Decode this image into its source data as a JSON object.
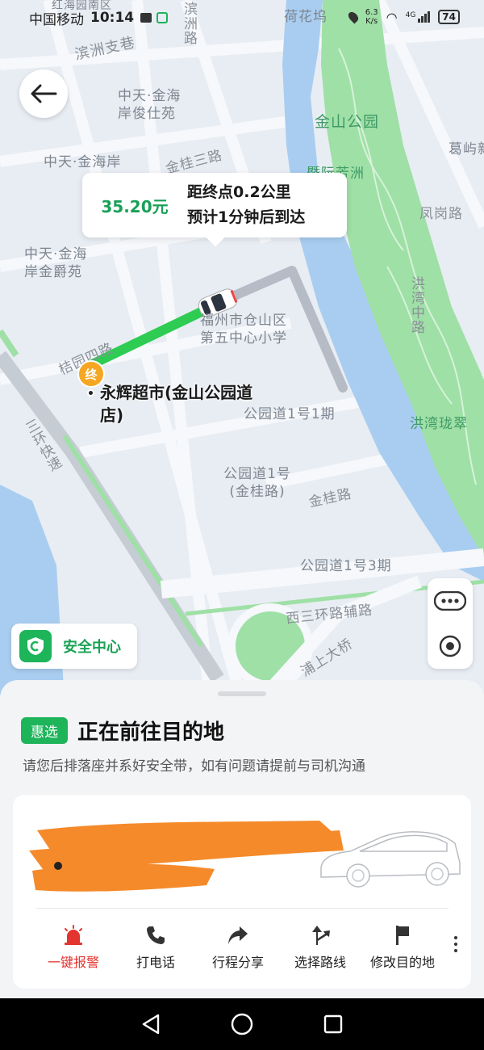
{
  "status_bar": {
    "carrier": "中国移动",
    "time": "10:14",
    "net_speed_value": "6.3",
    "net_speed_unit": "K/s",
    "signal": "4G",
    "battery": "74"
  },
  "map": {
    "labels": {
      "binzhou_branch": "滨洲支巷",
      "binzhou_road": "滨洲路",
      "honghai": "红海园南区",
      "hehuawu": "荷花坞",
      "zhongtian_junshi": "中天·金海岸俊仕苑",
      "zhongtian_coast": "中天·金海岸",
      "jinshan_park": "金山公园",
      "gequ": "葛屿新",
      "fenggang_road": "凤岗路",
      "fangzhou": "暨阮芳洲",
      "jingui_three": "金桂三路",
      "zhongtian_jinjue": "中天·金海岸金爵苑",
      "hongwan_road": "洪湾中路",
      "school": "福州市仓山区第五中心小学",
      "jingui_four": "桔园四路",
      "hongwan_bay": "洪湾珑翠",
      "park_phase1": "公园道1号1期",
      "third_ring": "三环快速",
      "park_jingui": "公园道1号(金桂路)",
      "jingui_road": "金桂路",
      "park_phase3": "公园道1号3期",
      "west_third_ring": "西三环路辅路",
      "pushang_bridge": "浦上大桥"
    },
    "destination_marker": "终",
    "destination_name": "永辉超市(金山公园道店)"
  },
  "info_bubble": {
    "fare": "35.20元",
    "distance": "距终点0.2公里",
    "eta": "预计1分钟后到达"
  },
  "safety_center": {
    "label": "安全中心"
  },
  "trip": {
    "badge": "惠选",
    "title": "正在前往目的地",
    "subtitle": "请您后排落座并系好安全带，如有问题请提前与司机沟通"
  },
  "actions": [
    {
      "label": "一键报警",
      "icon": "alarm-icon"
    },
    {
      "label": "打电话",
      "icon": "phone-icon"
    },
    {
      "label": "行程分享",
      "icon": "share-icon"
    },
    {
      "label": "选择路线",
      "icon": "route-icon"
    },
    {
      "label": "修改目的地",
      "icon": "flag-icon"
    }
  ],
  "colors": {
    "accent_green": "#1db45a",
    "alarm_red": "#e3342f",
    "route_green": "#2ecc52",
    "river_blue": "#a9cdf0",
    "park_green": "#9fe0a6"
  }
}
